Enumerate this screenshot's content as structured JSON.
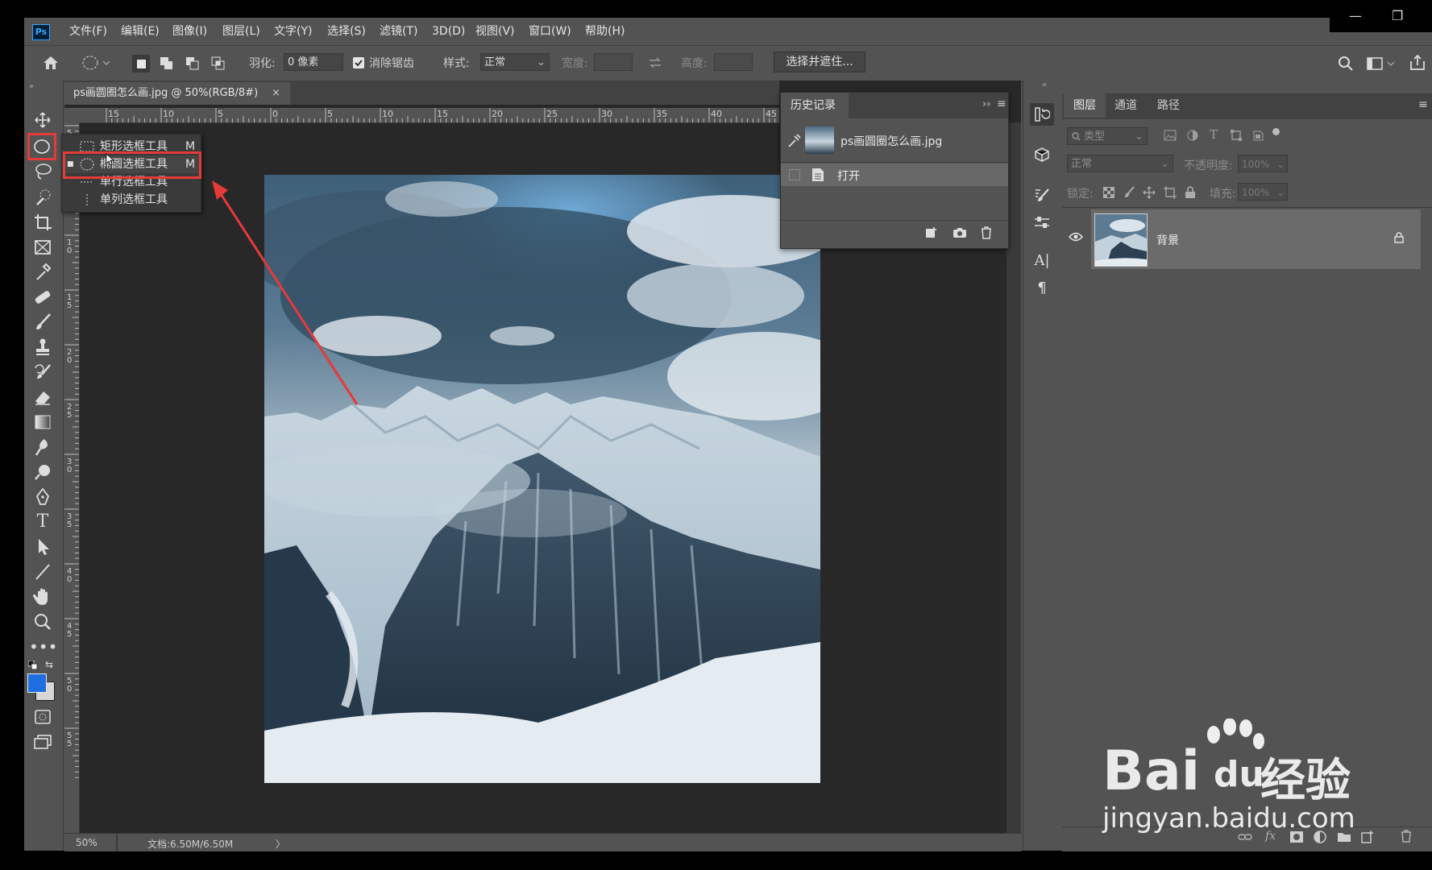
{
  "menubar": {
    "app_icon": "Ps",
    "items": [
      "文件(F)",
      "编辑(E)",
      "图像(I)",
      "图层(L)",
      "文字(Y)",
      "选择(S)",
      "滤镜(T)",
      "3D(D)",
      "视图(V)",
      "窗口(W)",
      "帮助(H)"
    ],
    "minimize": "—",
    "restore": "❐"
  },
  "options": {
    "feather_label": "羽化:",
    "feather_value": "0 像素",
    "antialias_label": "消除锯齿",
    "style_label": "样式:",
    "style_value": "正常",
    "width_label": "宽度:",
    "height_label": "高度:",
    "select_mask_button": "选择并遮住..."
  },
  "document": {
    "tab_title": "ps画圆圈怎么画.jpg @ 50%(RGB/8#)",
    "tab_close": "×",
    "zoom": "50%",
    "doc_size": "文档:6.50M/6.50M",
    "status_arrow": "〉"
  },
  "ruler": {
    "h_ticks": [
      "15",
      "10",
      "5",
      "0",
      "5",
      "10",
      "15",
      "20",
      "25",
      "30",
      "35",
      "40",
      "45"
    ],
    "v_ticks": [
      "5",
      "5",
      "10",
      "15",
      "20",
      "25",
      "30",
      "35",
      "40",
      "45",
      "50",
      "55"
    ]
  },
  "flyout": {
    "items": [
      {
        "label": "矩形选框工具",
        "key": "M"
      },
      {
        "label": "椭圆选框工具",
        "key": "M"
      },
      {
        "label": "单行选框工具",
        "key": ""
      },
      {
        "label": "单列选框工具",
        "key": ""
      }
    ]
  },
  "history": {
    "title": "历史记录",
    "snapshot": "ps画圆圈怎么画.jpg",
    "step_open": "打开"
  },
  "layers": {
    "tabs": [
      "图层",
      "通道",
      "路径"
    ],
    "filter_placeholder": "类型",
    "blend_mode": "正常",
    "opacity_label": "不透明度:",
    "opacity_value": "100%",
    "lock_label": "锁定:",
    "fill_label": "填充:",
    "fill_value": "100%",
    "layer_name": "背景"
  },
  "watermark": {
    "brand": "Bai",
    "brand2": "du",
    "cn": "经验",
    "url": "jingyan.baidu.com"
  },
  "colors": {
    "panel": "#535353",
    "canvas_bg": "#282828",
    "highlight_red": "#e53a3a",
    "foreground": "#1f6fe0"
  }
}
